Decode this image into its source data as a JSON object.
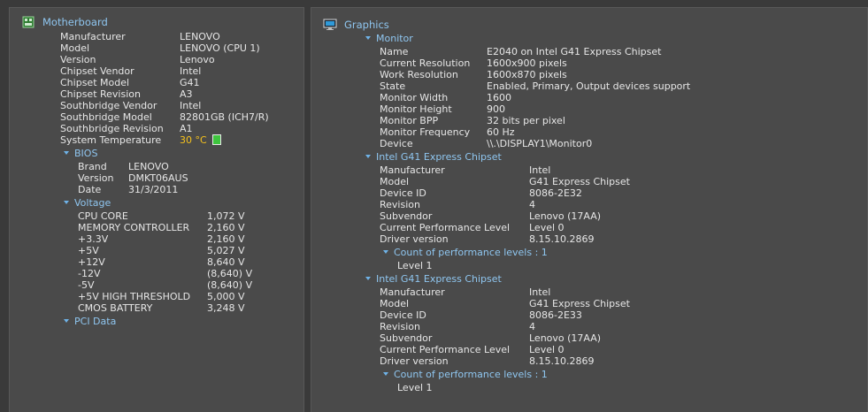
{
  "motherboard": {
    "title": "Motherboard",
    "rows": [
      {
        "label": "Manufacturer",
        "value": "LENOVO"
      },
      {
        "label": "Model",
        "value": "LENOVO (CPU 1)"
      },
      {
        "label": "Version",
        "value": "Lenovo"
      },
      {
        "label": "Chipset Vendor",
        "value": "Intel"
      },
      {
        "label": "Chipset Model",
        "value": "G41"
      },
      {
        "label": "Chipset Revision",
        "value": "A3"
      },
      {
        "label": "Southbridge Vendor",
        "value": "Intel"
      },
      {
        "label": "Southbridge Model",
        "value": "82801GB (ICH7/R)"
      },
      {
        "label": "Southbridge Revision",
        "value": "A1"
      }
    ],
    "temperature": {
      "label": "System Temperature",
      "value": "30 °C"
    },
    "bios": {
      "title": "BIOS",
      "rows": [
        {
          "label": "Brand",
          "value": "LENOVO"
        },
        {
          "label": "Version",
          "value": "DMKT06AUS"
        },
        {
          "label": "Date",
          "value": "31/3/2011"
        }
      ]
    },
    "voltage": {
      "title": "Voltage",
      "rows": [
        {
          "label": "CPU CORE",
          "value": "1,072 V"
        },
        {
          "label": "MEMORY CONTROLLER",
          "value": "2,160 V"
        },
        {
          "label": "+3.3V",
          "value": "2,160 V"
        },
        {
          "label": "+5V",
          "value": "5,027 V"
        },
        {
          "label": "+12V",
          "value": "8,640 V"
        },
        {
          "label": "-12V",
          "value": "(8,640) V"
        },
        {
          "label": "-5V",
          "value": "(8,640) V"
        },
        {
          "label": "+5V HIGH THRESHOLD",
          "value": "5,000 V"
        },
        {
          "label": "CMOS BATTERY",
          "value": "3,248 V"
        }
      ]
    },
    "pci": {
      "title": "PCI Data"
    }
  },
  "graphics": {
    "title": "Graphics",
    "monitor": {
      "title": "Monitor",
      "rows": [
        {
          "label": "Name",
          "value": "E2040 on Intel G41 Express Chipset"
        },
        {
          "label": "Current Resolution",
          "value": "1600x900 pixels"
        },
        {
          "label": "Work Resolution",
          "value": "1600x870 pixels"
        },
        {
          "label": "State",
          "value": "Enabled, Primary, Output devices support"
        },
        {
          "label": "Monitor Width",
          "value": "1600"
        },
        {
          "label": "Monitor Height",
          "value": "900"
        },
        {
          "label": "Monitor BPP",
          "value": "32 bits per pixel"
        },
        {
          "label": "Monitor Frequency",
          "value": "60 Hz"
        },
        {
          "label": "Device",
          "value": "\\\\.\\DISPLAY1\\Monitor0"
        }
      ]
    },
    "adapters": [
      {
        "title": "Intel G41 Express Chipset",
        "rows": [
          {
            "label": "Manufacturer",
            "value": "Intel"
          },
          {
            "label": "Model",
            "value": "G41 Express Chipset"
          },
          {
            "label": "Device ID",
            "value": "8086-2E32"
          },
          {
            "label": "Revision",
            "value": "4"
          },
          {
            "label": "Subvendor",
            "value": "Lenovo (17AA)"
          },
          {
            "label": "Current Performance Level",
            "value": "Level 0"
          },
          {
            "label": "Driver version",
            "value": "8.15.10.2869"
          }
        ],
        "perf_title": "Count of performance levels : 1",
        "perf_item": "Level 1"
      },
      {
        "title": "Intel G41 Express Chipset",
        "rows": [
          {
            "label": "Manufacturer",
            "value": "Intel"
          },
          {
            "label": "Model",
            "value": "G41 Express Chipset"
          },
          {
            "label": "Device ID",
            "value": "8086-2E33"
          },
          {
            "label": "Revision",
            "value": "4"
          },
          {
            "label": "Subvendor",
            "value": "Lenovo (17AA)"
          },
          {
            "label": "Current Performance Level",
            "value": "Level 0"
          },
          {
            "label": "Driver version",
            "value": "8.15.10.2869"
          }
        ],
        "perf_title": "Count of performance levels : 1",
        "perf_item": "Level 1"
      }
    ]
  },
  "colors": {
    "accent": "#8fc6f0",
    "warning": "#f6c21d",
    "panel": "#4a4a4a",
    "background": "#3a3a3a"
  },
  "icons": {
    "motherboard": "chip-icon",
    "graphics": "monitor-icon",
    "expand": "expand-triangle-icon",
    "temperature": "temperature-indicator-icon"
  }
}
